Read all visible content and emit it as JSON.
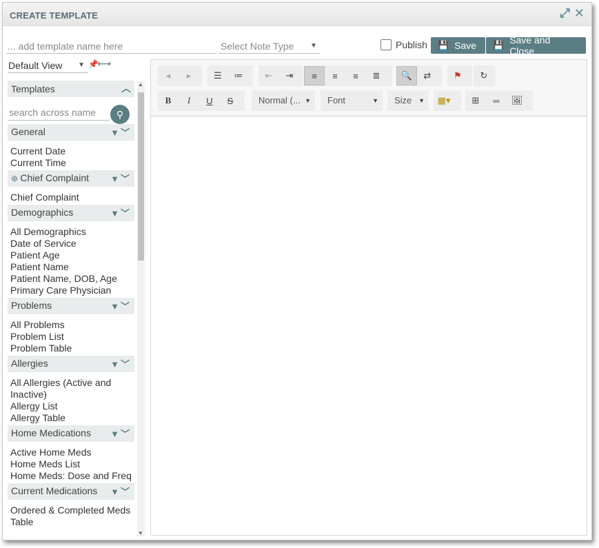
{
  "window": {
    "title": "CREATE TEMPLATE",
    "icons": [
      "expand-icon",
      "close-icon"
    ]
  },
  "header": {
    "name_placeholder": "... add template name here",
    "note_type": "Select Note Type",
    "publish_label": "Publish",
    "publish_checked": false,
    "save_label": "Save",
    "save_close_label": "Save and Close"
  },
  "sidebar": {
    "view": "Default View",
    "panel_title": "Templates",
    "search_placeholder": "search across name",
    "groups": [
      {
        "name": "General",
        "items": [
          "Current Date",
          "Current Time"
        ]
      },
      {
        "name": "Chief Complaint",
        "items": [
          "Chief Complaint"
        ]
      },
      {
        "name": "Demographics",
        "items": [
          "All Demographics",
          "Date of Service",
          "Patient Age",
          "Patient Name",
          "Patient Name, DOB, Age",
          "Primary Care Physician"
        ]
      },
      {
        "name": "Problems",
        "items": [
          "All Problems",
          "Problem List",
          "Problem Table"
        ]
      },
      {
        "name": "Allergies",
        "items": [
          "All Allergies (Active and Inactive)",
          "Allergy List",
          "Allergy Table"
        ]
      },
      {
        "name": "Home Medications",
        "items": [
          "Active Home Meds",
          "Home Meds List",
          "Home Meds: Dose and Freq"
        ]
      },
      {
        "name": "Current Medications",
        "items": [
          "Ordered & Completed Meds Table"
        ]
      }
    ]
  },
  "editor": {
    "format_select": "Normal (...",
    "font_select": "Font",
    "size_select": "Size"
  },
  "colors": {
    "accent": "#5b7d84",
    "header_bg": "#e9ecec"
  }
}
